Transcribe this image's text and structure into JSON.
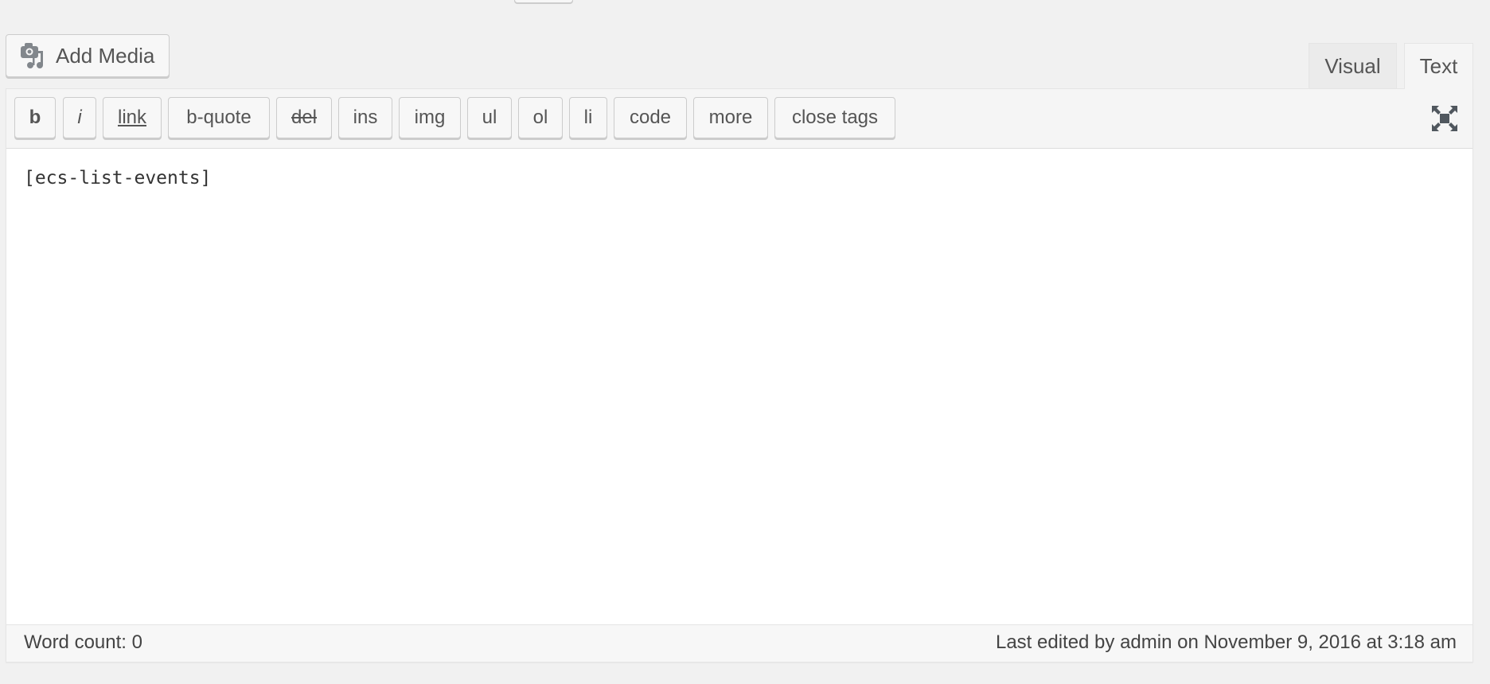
{
  "header": {
    "add_media_label": "Add Media",
    "add_media_icon": "media-camera-music-icon"
  },
  "tabs": [
    {
      "label": "Visual",
      "active": false
    },
    {
      "label": "Text",
      "active": true
    }
  ],
  "toolbar": {
    "buttons": [
      {
        "label": "b",
        "style": "bold"
      },
      {
        "label": "i",
        "style": "italic"
      },
      {
        "label": "link",
        "style": "underline"
      },
      {
        "label": "b-quote",
        "style": "normal"
      },
      {
        "label": "del",
        "style": "strikethrough"
      },
      {
        "label": "ins",
        "style": "normal"
      },
      {
        "label": "img",
        "style": "normal"
      },
      {
        "label": "ul",
        "style": "normal"
      },
      {
        "label": "ol",
        "style": "normal"
      },
      {
        "label": "li",
        "style": "normal"
      },
      {
        "label": "code",
        "style": "normal"
      },
      {
        "label": "more",
        "style": "normal"
      },
      {
        "label": "close tags",
        "style": "normal"
      }
    ],
    "fullscreen_icon": "fullscreen-expand-icon"
  },
  "editor": {
    "content": "[ecs-list-events]"
  },
  "status": {
    "word_count": "Word count: 0",
    "last_edited": "Last edited by admin on November 9, 2016 at 3:18 am"
  }
}
